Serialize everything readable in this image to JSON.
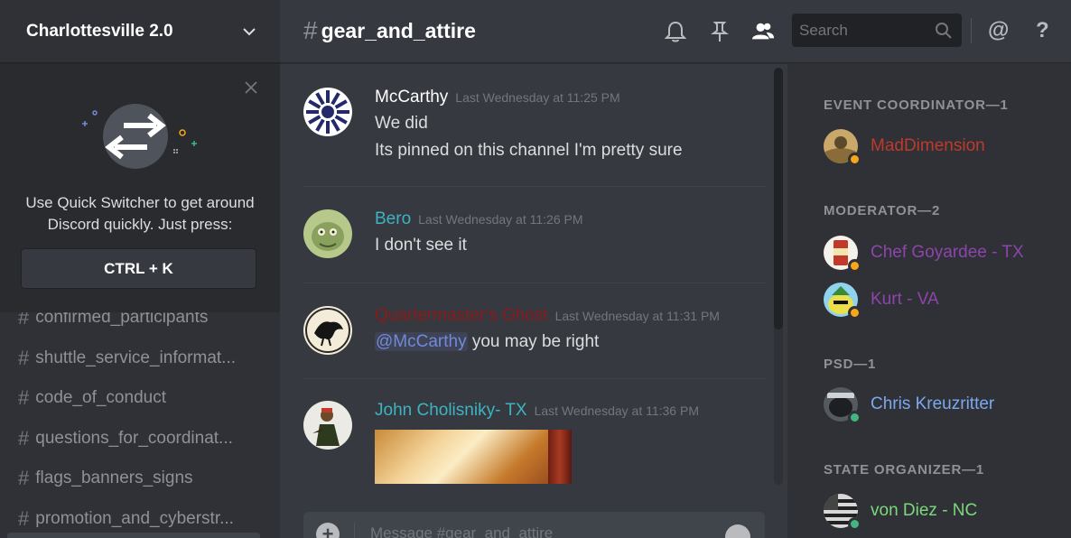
{
  "server": {
    "name": "Charlottesville 2.0"
  },
  "quick_switcher": {
    "text": "Use Quick Switcher to get around Discord quickly. Just press:",
    "shortcut": "CTRL + K"
  },
  "channels": [
    {
      "name": "confirmed_participants"
    },
    {
      "name": "shuttle_service_informat..."
    },
    {
      "name": "code_of_conduct"
    },
    {
      "name": "questions_for_coordinat..."
    },
    {
      "name": "flags_banners_signs"
    },
    {
      "name": "promotion_and_cyberstr..."
    }
  ],
  "channel_header": {
    "hash": "#",
    "name": "gear_and_attire",
    "search_placeholder": "Search",
    "at_symbol": "@",
    "help_symbol": "?"
  },
  "messages": [
    {
      "author": "McCarthy",
      "color": "#ffffff",
      "timestamp": "Last Wednesday at 11:25 PM",
      "lines": [
        "We did",
        "Its pinned on this channel I'm pretty sure"
      ]
    },
    {
      "author": "Bero",
      "color": "#3eb3c1",
      "timestamp": "Last Wednesday at 11:26 PM",
      "lines": [
        "I don't see it"
      ]
    },
    {
      "author": "Quartermaster's Ghost",
      "color": "#8b1a1a",
      "timestamp": "Last Wednesday at 11:31 PM",
      "mention": "@McCarthy",
      "line_rest": " you may be right"
    },
    {
      "author": "John Cholisniky- TX",
      "color": "#3eb3c1",
      "timestamp": "Last Wednesday at 11:36 PM"
    }
  ],
  "composer": {
    "placeholder": "Message #gear_and_attire"
  },
  "members": {
    "roles": [
      {
        "title": "EVENT COORDINATOR—1",
        "members": [
          {
            "name": "MadDimension",
            "color": "#c0392b",
            "status": "#faa61a"
          }
        ]
      },
      {
        "title": "MODERATOR—2",
        "members": [
          {
            "name": "Chef Goyardee - TX",
            "color": "#8e44ad",
            "status": "#faa61a"
          },
          {
            "name": "Kurt - VA",
            "color": "#8e44ad",
            "status": "#faa61a"
          }
        ]
      },
      {
        "title": "PSD—1",
        "members": [
          {
            "name": "Chris Kreuzritter",
            "color": "#7aa9f0",
            "status": "#43b581"
          }
        ]
      },
      {
        "title": "STATE ORGANIZER—1",
        "members": [
          {
            "name": "von Diez - NC",
            "color": "#7dd87d",
            "status": "#43b581"
          }
        ]
      }
    ]
  }
}
